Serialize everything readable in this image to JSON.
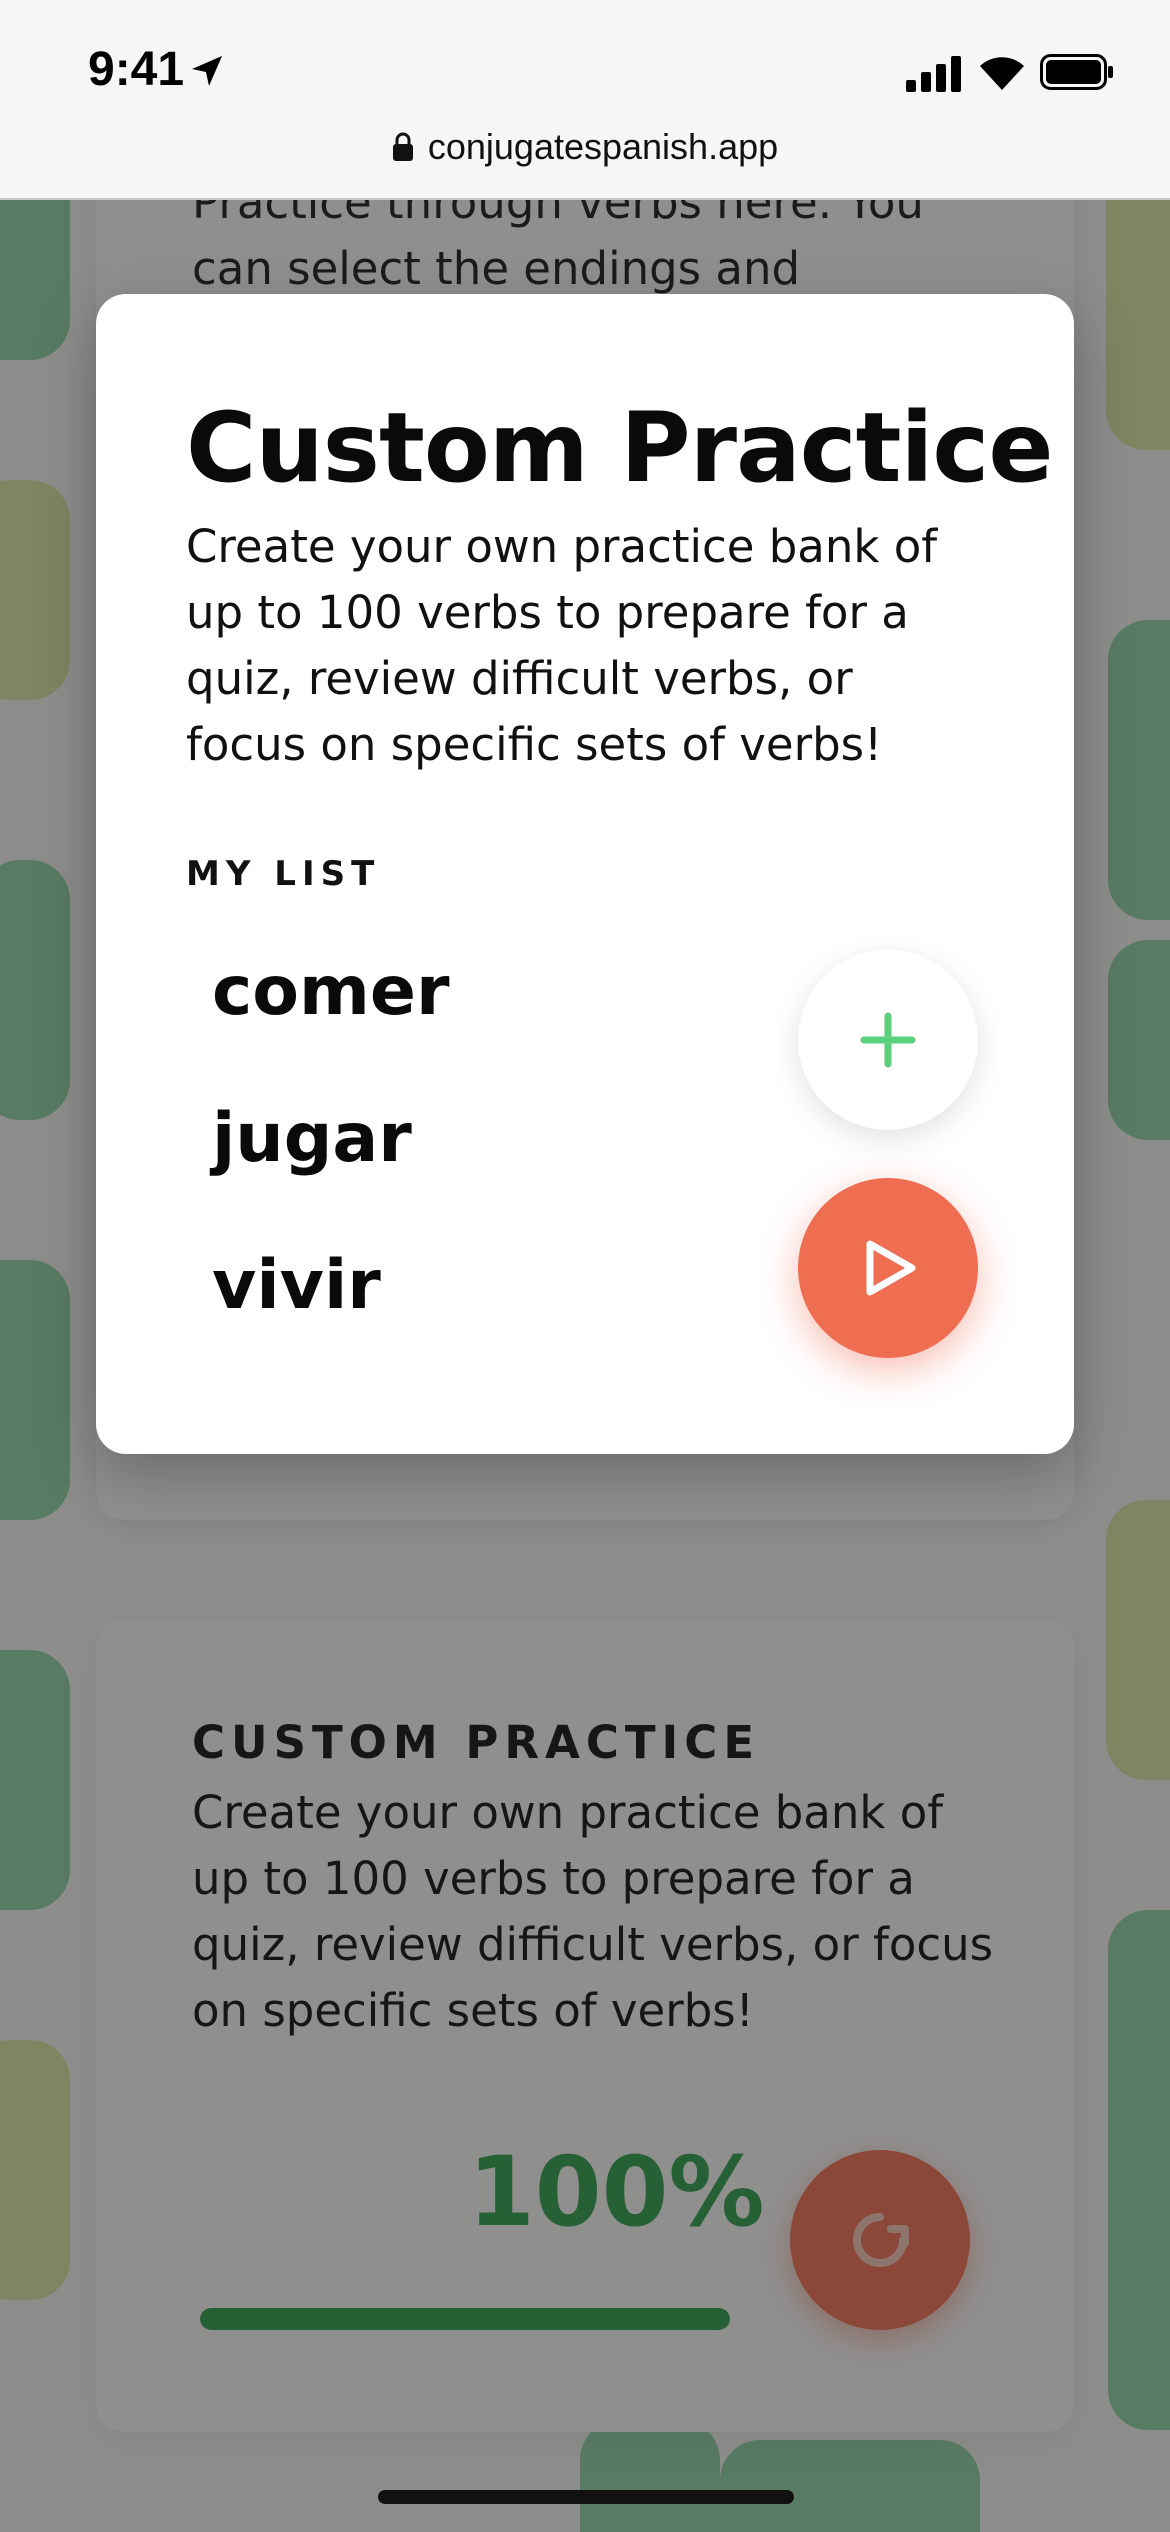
{
  "status_bar": {
    "time": "9:41",
    "icons": [
      "location-arrow-icon",
      "signal-bars-icon",
      "wifi-icon",
      "battery-icon"
    ]
  },
  "browser": {
    "url": "conjugatespanish.app",
    "url_icon": "lock-icon"
  },
  "background": {
    "intro_text": "Practice through verbs here. You can select the endings and",
    "custom_card": {
      "heading": "CUSTOM PRACTICE",
      "description": "Create your own practice bank of up to 100 verbs to prepare for a quiz, review difficult verbs, or focus on specific sets of verbs!",
      "progress_text": "100%",
      "progress_value": 1.0,
      "restart_icon": "refresh-icon"
    },
    "colors": {
      "green": "#2e9e4c",
      "accent": "#ef6d51",
      "pattern_green": "#8fd1a3",
      "pattern_yellow": "#d9e3a0"
    }
  },
  "modal": {
    "title": "Custom Practice",
    "description": "Create your own practice bank of up to 100 verbs to prepare for a quiz, review difficult verbs, or focus on specific sets of verbs!",
    "list_label": "MY LIST",
    "verbs": [
      "comer",
      "jugar",
      "vivir"
    ],
    "add_icon": "plus-icon",
    "play_icon": "play-icon",
    "colors": {
      "plus": "#5ccf7a",
      "play_button": "#ef6d51"
    }
  }
}
